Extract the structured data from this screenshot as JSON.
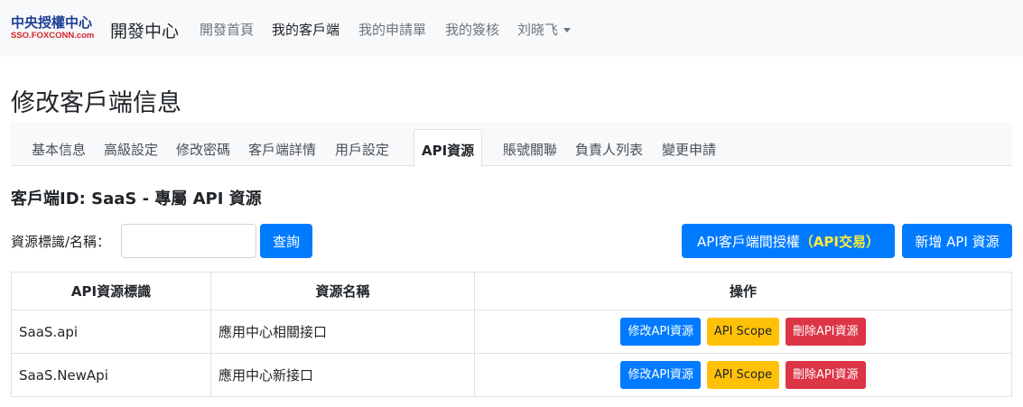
{
  "navbar": {
    "logo_line1": "中央授權中心",
    "logo_line2": "SSO.FOXCONN.com",
    "brand_title": "開發中心",
    "links": [
      {
        "label": "開發首頁"
      },
      {
        "label": "我的客戶端"
      },
      {
        "label": "我的申請單"
      },
      {
        "label": "我的簽核"
      },
      {
        "label": "刘晓飞"
      }
    ]
  },
  "page": {
    "title": "修改客戶端信息"
  },
  "tabs": [
    {
      "label": "基本信息"
    },
    {
      "label": "高級設定"
    },
    {
      "label": "修改密碼"
    },
    {
      "label": "客戶端詳情"
    },
    {
      "label": "用戶設定"
    },
    {
      "label": "API資源"
    },
    {
      "label": "賬號關聯"
    },
    {
      "label": "負責人列表"
    },
    {
      "label": "變更申請"
    }
  ],
  "subtitle": "客戶端ID: SaaS   -   專屬 API 資源",
  "search": {
    "label": "資源標識/名稱：",
    "value": "",
    "placeholder": "",
    "query_label": "查詢"
  },
  "actions": {
    "grant_label": "API客戶端間授權",
    "grant_highlight": "（API交易）",
    "new_label": "新增 API 資源"
  },
  "table": {
    "headers": [
      "API資源標識",
      "資源名稱",
      "操作"
    ],
    "rows": [
      {
        "id": "SaaS.api",
        "name": "應用中心相關接口"
      },
      {
        "id": "SaaS.NewApi",
        "name": "應用中心新接口"
      }
    ],
    "op_edit": "修改API資源",
    "op_scope": "API Scope",
    "op_delete": "刪除API資源"
  },
  "colors": {
    "primary": "#007bff",
    "warning": "#ffc107",
    "danger": "#dc3545",
    "highlight": "#ffeb3b"
  }
}
